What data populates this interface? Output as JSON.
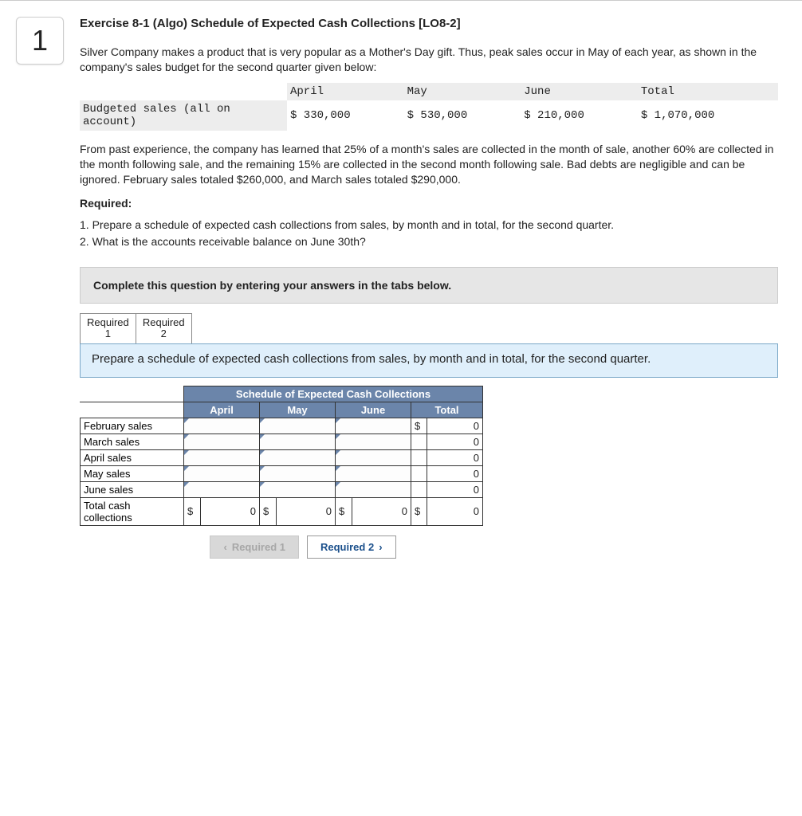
{
  "question_number": "1",
  "title": "Exercise 8-1 (Algo) Schedule of Expected Cash Collections [LO8-2]",
  "intro": "Silver Company makes a product that is very popular as a Mother's Day gift. Thus, peak sales occur in May of each year, as shown in the company's sales budget for the second quarter given below:",
  "budget": {
    "row_label": "Budgeted sales (all on account)",
    "columns": [
      "April",
      "May",
      "June",
      "Total"
    ],
    "values": [
      "$ 330,000",
      "$ 530,000",
      "$ 210,000",
      "$ 1,070,000"
    ]
  },
  "past_experience": "From past experience, the company has learned that 25% of a month's sales are collected in the month of sale, another 60% are collected in the month following sale, and the remaining 15% are collected in the second month following sale. Bad debts are negligible and can be ignored. February sales totaled $260,000, and March sales totaled $290,000.",
  "required_label": "Required:",
  "required_items": [
    "1. Prepare a schedule of expected cash collections from sales, by month and in total, for the second quarter.",
    "2. What is the accounts receivable balance on June 30th?"
  ],
  "instruction_bar": "Complete this question by entering your answers in the tabs below.",
  "tabs": {
    "tab1": "Required 1",
    "tab2": "Required 2"
  },
  "panel_text": "Prepare a schedule of expected cash collections from sales, by month and in total, for the second quarter.",
  "worksheet": {
    "title": "Schedule of Expected Cash Collections",
    "cols": [
      "April",
      "May",
      "June",
      "Total"
    ],
    "rows": [
      {
        "label": "February sales",
        "vals": [
          "",
          "",
          "",
          "0"
        ],
        "dollar": "$"
      },
      {
        "label": "March sales",
        "vals": [
          "",
          "",
          "",
          "0"
        ],
        "dollar": ""
      },
      {
        "label": "April sales",
        "vals": [
          "",
          "",
          "",
          "0"
        ],
        "dollar": ""
      },
      {
        "label": "May sales",
        "vals": [
          "",
          "",
          "",
          "0"
        ],
        "dollar": ""
      },
      {
        "label": "June sales",
        "vals": [
          "",
          "",
          "",
          "0"
        ],
        "dollar": ""
      }
    ],
    "total_row": {
      "label": "Total cash collections",
      "vals": [
        "0",
        "0",
        "0",
        "0"
      ],
      "currency": "$"
    }
  },
  "nav": {
    "prev": "Required 1",
    "next": "Required 2"
  }
}
